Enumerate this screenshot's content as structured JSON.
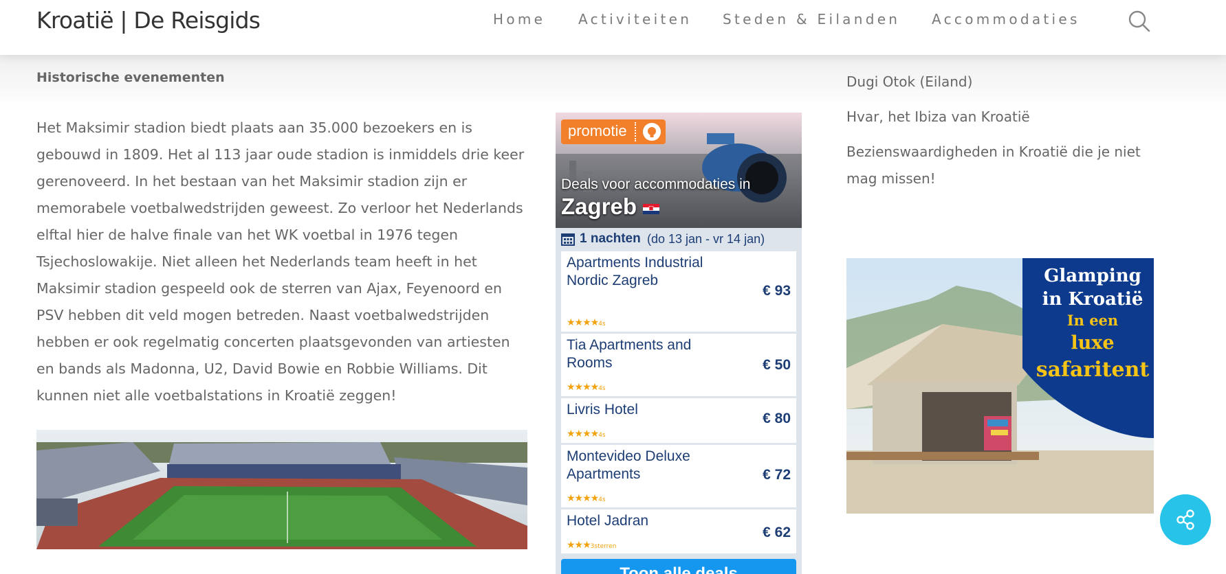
{
  "header": {
    "site_title": "Kroatië | De Reisgids",
    "nav": [
      "Home",
      "Activiteiten",
      "Steden & Eilanden",
      "Accommodaties"
    ],
    "search_icon": "search-icon"
  },
  "article": {
    "heading": "Historische evenementen",
    "body": "Het Maksimir stadion biedt plaats aan 35.000 bezoekers en is gebouwd in 1809. Het al 113 jaar oude stadion is inmiddels drie keer gerenoveerd. In het bestaan van het Maksimir stadion zijn er memorabele voetbalwedstrijden geweest. Zo verloor het Nederlands elftal hier de halve finale van het WK voetbal in 1976 tegen Tsjechoslowakije. Niet alleen het Nederlands team heeft in het Maksimir stadion gespeeld ook de sterren van Ajax, Feyenoord en PSV hebben dit veld mogen betreden. Naast voetbalwedstrijden hebben er ook regelmatig concerten plaatsgevonden van artiesten en bands als Madonna, U2, David Bowie en Robbie Williams. Dit kunnen niet alle voetbalstations in Kroatië zeggen!"
  },
  "widget": {
    "promo_label": "promotie",
    "hero_subtitle": "Deals voor accommodaties in",
    "hero_city": "Zagreb",
    "nights_label": "1 nachten",
    "dates_label": "(do 13 jan - vr 14 jan)",
    "hotels": [
      {
        "name": "Apartments Industrial Nordic Zagreb",
        "price": "€ 93",
        "stars": "★★★★",
        "stars_suffix": "4s"
      },
      {
        "name": "Tia Apartments and Rooms",
        "price": "€ 50",
        "stars": "★★★★",
        "stars_suffix": "4s"
      },
      {
        "name": "Livris Hotel",
        "price": "€ 80",
        "stars": "★★★★",
        "stars_suffix": "4s"
      },
      {
        "name": "Montevideo Deluxe Apartments",
        "price": "€ 72",
        "stars": "★★★★",
        "stars_suffix": "4s"
      },
      {
        "name": "Hotel Jadran",
        "price": "€ 62",
        "stars": "★★★",
        "stars_suffix": "3sterren"
      }
    ],
    "cta_label": "Toon alle deals"
  },
  "sidebar": {
    "links": [
      "Dugi Otok (Eiland)",
      "Hvar, het Ibiza van Kroatië",
      "Bezienswaardigheden in Kroatië die je niet mag missen!"
    ],
    "ad": {
      "line1": "Glamping",
      "line2": "in Kroatië",
      "line3": "In een",
      "line4": "luxe",
      "line5": "safaritent"
    }
  },
  "colors": {
    "accent": "#27c3e8",
    "widget_navy": "#1d3d75",
    "promo_orange": "#f27f2a",
    "ad_navy": "#0d3a8c",
    "ad_yellow": "#f6c416"
  }
}
